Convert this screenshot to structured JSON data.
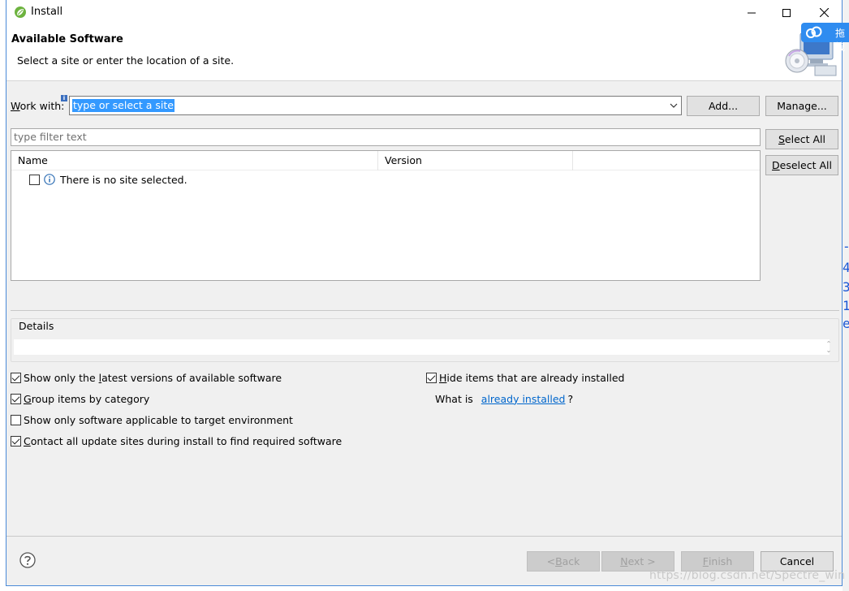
{
  "window": {
    "title": "Install"
  },
  "banner": {
    "title": "Available Software",
    "description": "Select a site or enter the location of a site."
  },
  "work_with": {
    "label_mnemonic": "W",
    "label_rest": "ork with:",
    "value": "type or select a site",
    "add_label": "Add...",
    "manage_label": "Manage..."
  },
  "filter": {
    "placeholder": "type filter text"
  },
  "side_buttons": {
    "select_all_mnemonic": "S",
    "select_all_rest": "elect All",
    "deselect_all_mnemonic": "D",
    "deselect_all_rest": "eselect All"
  },
  "table": {
    "columns": [
      "Name",
      "Version"
    ],
    "rows": [
      {
        "checked": false,
        "text": "There is no site selected."
      }
    ]
  },
  "details": {
    "label": "Details"
  },
  "options": {
    "latest": {
      "checked": true,
      "pre": "Show only the ",
      "mnemonic": "l",
      "post": "atest versions of available software"
    },
    "group": {
      "checked": true,
      "pre": "",
      "mnemonic": "G",
      "post": "roup items by category"
    },
    "target": {
      "checked": false,
      "pre": "Show only software applicable to target environment",
      "mnemonic": "",
      "post": ""
    },
    "contact": {
      "checked": true,
      "pre": "",
      "mnemonic": "C",
      "post": "ontact all update sites during install to find required software"
    },
    "hide": {
      "checked": true,
      "pre": "",
      "mnemonic": "H",
      "post": "ide items that are already installed"
    }
  },
  "what_is": {
    "pre": "What is ",
    "link": "already installed",
    "post": "?"
  },
  "footer": {
    "back_mnemonic": "B",
    "back_pre": "< ",
    "back_rest": "ack",
    "next_mnemonic": "N",
    "next_rest": "ext >",
    "finish_mnemonic": "F",
    "finish_rest": "inish",
    "cancel_label": "Cancel"
  },
  "float_tag": {
    "text": "拖拽"
  },
  "watermark": "https://blog.csdn.net/Spectre_win",
  "colors": {
    "accent": "#0078d7",
    "selection": "#3399ff",
    "link": "#0066cc"
  },
  "icons": {
    "title": "eclipse-spring-icon",
    "info": "info-icon",
    "help": "help-icon",
    "banner": "install-cd-monitor-icon"
  }
}
